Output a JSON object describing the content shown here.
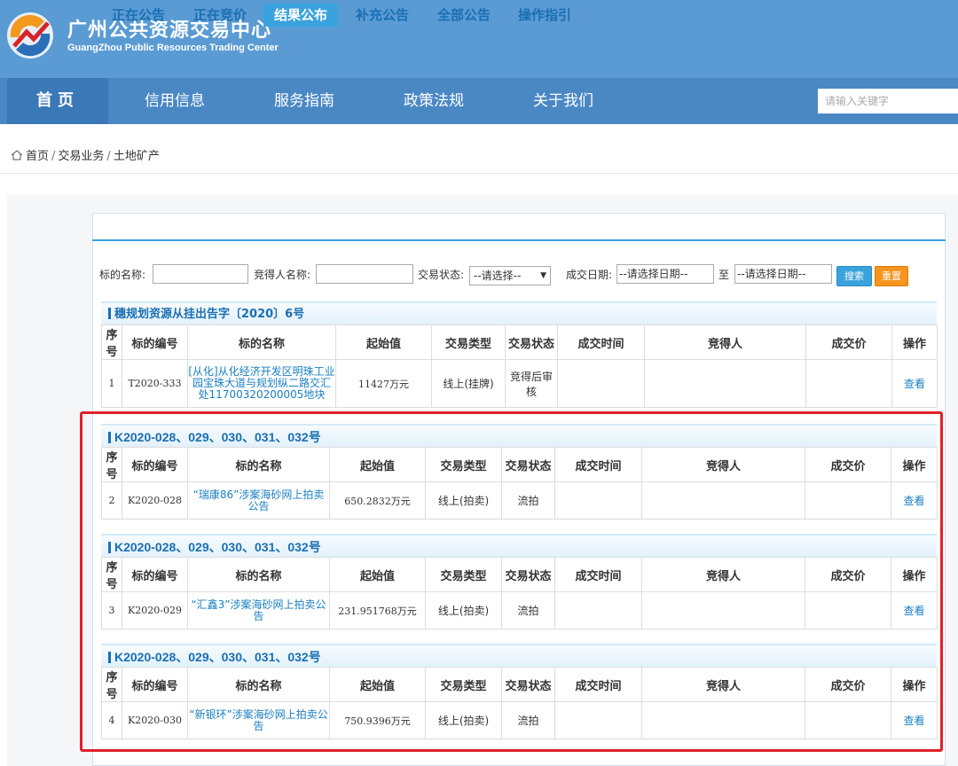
{
  "header": {
    "title_cn": "广州公共资源交易中心",
    "title_en": "GuangZhou Public Resources Trading Center"
  },
  "nav": {
    "items": [
      "首页",
      "信用信息",
      "服务指南",
      "政策法规",
      "关于我们"
    ],
    "search_placeholder": "请输入关键字"
  },
  "breadcrumb": [
    "首页",
    "交易业务",
    "土地矿产"
  ],
  "tabs": [
    "正在公告",
    "正在竞价",
    "结果公布",
    "补充公告",
    "全部公告",
    "操作指引"
  ],
  "active_tab": "结果公布",
  "filters": {
    "name_label": "标的名称:",
    "bidder_label": "竞得人名称:",
    "status_label": "交易状态:",
    "status_value": "--请选择--",
    "date_label": "成交日期:",
    "date_from": "--请选择日期--",
    "to_label": "至",
    "date_to": "--请选择日期--",
    "search_btn": "搜索",
    "reset_btn": "重置"
  },
  "columns": [
    "序号",
    "标的编号",
    "标的名称",
    "起始值",
    "交易类型",
    "交易状态",
    "成交时间",
    "竞得人",
    "成交价",
    "操作"
  ],
  "sections": [
    {
      "title": "穗规划资源从挂出告字〔2020〕6号",
      "row": {
        "seq": "1",
        "code": "T2020-333",
        "name": "[从化]从化经济开发区明珠工业园宝珠大道与规划纵二路交汇处11700320200005地块",
        "start": "11427万元",
        "type": "线上(挂牌)",
        "status": "竞得后审核",
        "time": "",
        "bidder": "",
        "price": "",
        "action": "查看"
      }
    },
    {
      "title": "K2020-028、029、030、031、032号",
      "row": {
        "seq": "2",
        "code": "K2020-028",
        "name": "“瑞康86”涉案海砂网上拍卖公告",
        "start": "650.2832万元",
        "type": "线上(拍卖)",
        "status": "流拍",
        "time": "",
        "bidder": "",
        "price": "",
        "action": "查看"
      }
    },
    {
      "title": "K2020-028、029、030、031、032号",
      "row": {
        "seq": "3",
        "code": "K2020-029",
        "name": "“汇鑫3”涉案海砂网上拍卖公告",
        "start": "231.951768万元",
        "type": "线上(拍卖)",
        "status": "流拍",
        "time": "",
        "bidder": "",
        "price": "",
        "action": "查看"
      }
    },
    {
      "title": "K2020-028、029、030、031、032号",
      "row": {
        "seq": "4",
        "code": "K2020-030",
        "name": "“新银环”涉案海砂网上拍卖公告",
        "start": "750.9396万元",
        "type": "线上(拍卖)",
        "status": "流拍",
        "time": "",
        "bidder": "",
        "price": "",
        "action": "查看"
      }
    }
  ],
  "colors": {
    "header": "#5a9bd4",
    "nav": "#4a88c4",
    "accent": "#3aa3de",
    "link": "#1a7fc1",
    "highlight": "#e0202a"
  }
}
